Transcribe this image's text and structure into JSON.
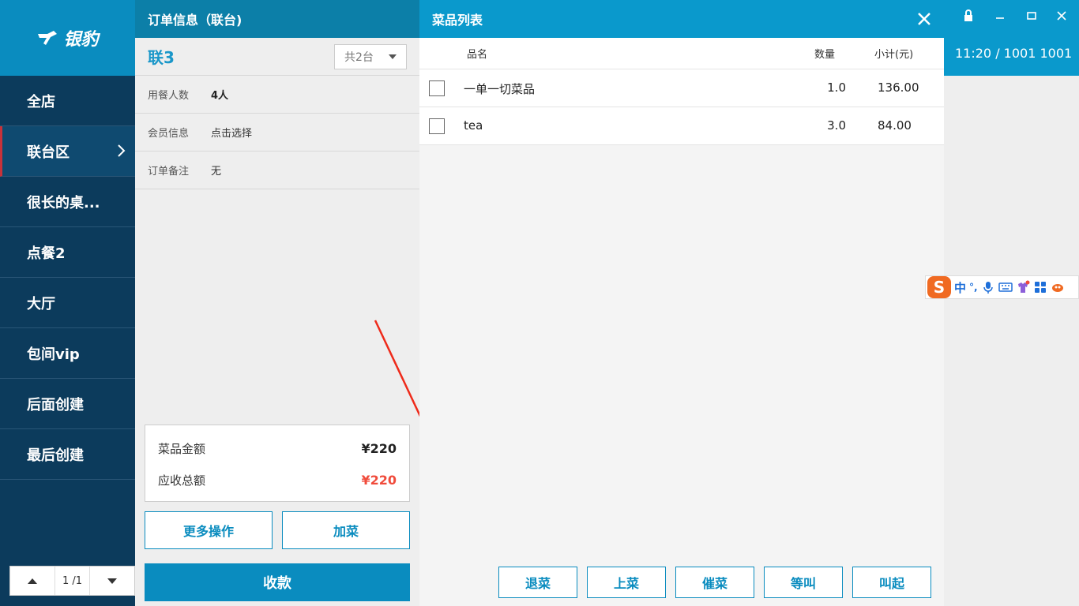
{
  "brand": {
    "name": "银豹"
  },
  "sidebar": {
    "items": [
      {
        "label": "全店"
      },
      {
        "label": "联台区"
      },
      {
        "label": "很长的桌..."
      },
      {
        "label": "点餐2"
      },
      {
        "label": "大厅"
      },
      {
        "label": "包间vip"
      },
      {
        "label": "后面创建"
      },
      {
        "label": "最后创建"
      }
    ],
    "active_index": 1,
    "pager": {
      "text": "1 /1"
    }
  },
  "order": {
    "header_title": "订单信息（联台)",
    "table_name": "联3",
    "table_count": "共2台",
    "rows": [
      {
        "label": "用餐人数",
        "value": "4人"
      },
      {
        "label": "会员信息",
        "value": "点击选择"
      },
      {
        "label": "订单备注",
        "value": "无"
      }
    ],
    "summary": {
      "dish_amount_label": "菜品金额",
      "dish_amount": "¥220",
      "receivable_label": "应收总额",
      "receivable": "¥220"
    },
    "more_actions": "更多操作",
    "add_dish": "加菜",
    "pay": "收款"
  },
  "dishes": {
    "header_title": "菜品列表",
    "columns": {
      "name": "品名",
      "qty": "数量",
      "subtotal": "小计(元)"
    },
    "items": [
      {
        "name": "一单一切菜品",
        "qty": "1.0",
        "subtotal": "136.00"
      },
      {
        "name": "tea",
        "qty": "3.0",
        "subtotal": "84.00"
      }
    ],
    "buttons": [
      "退菜",
      "上菜",
      "催菜",
      "等叫",
      "叫起"
    ]
  },
  "status": {
    "time_line": "11:20  /  1001 1001"
  },
  "ime": {
    "logo": "S",
    "mode": "中",
    "punct": "°,"
  },
  "colors": {
    "primary": "#0a8cbf",
    "sidebar": "#0c3b5c",
    "accent_red": "#f04b3b",
    "active_marker": "#c8323a"
  }
}
